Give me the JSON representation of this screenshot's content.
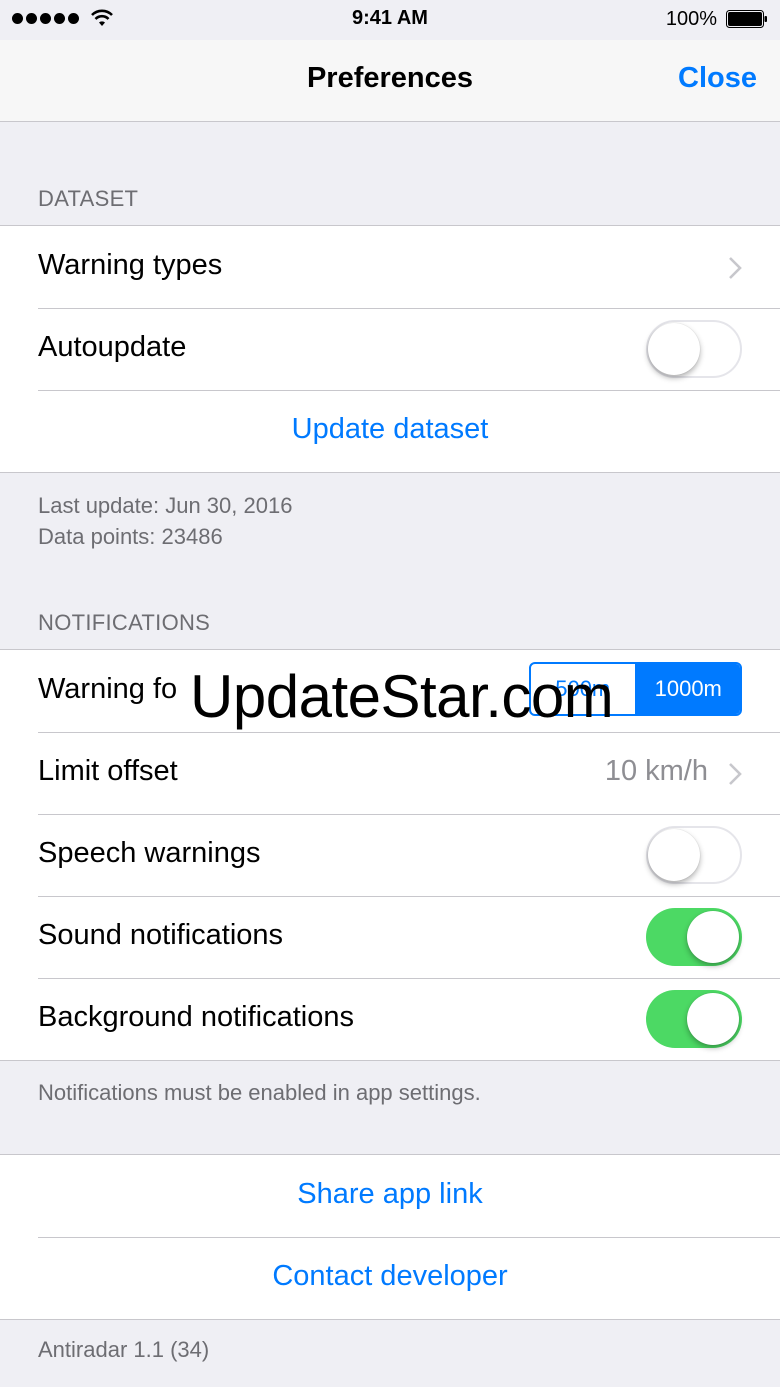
{
  "status_bar": {
    "time": "9:41 AM",
    "battery_percent": "100%",
    "signal_icon": "signal-dots-icon",
    "wifi_icon": "wifi-icon",
    "battery_icon": "battery-icon"
  },
  "nav": {
    "title": "Preferences",
    "close_label": "Close"
  },
  "dataset": {
    "header": "DATASET",
    "warning_types_label": "Warning types",
    "autoupdate_label": "Autoupdate",
    "autoupdate_on": false,
    "update_action": "Update dataset",
    "footer_line1": "Last update: Jun 30, 2016",
    "footer_line2": "Data points: 23486"
  },
  "notifications": {
    "header": "NOTIFICATIONS",
    "warning_for_label": "Warning fo",
    "distance_options": [
      "500m",
      "1000m"
    ],
    "distance_selected": "1000m",
    "limit_offset_label": "Limit offset",
    "limit_offset_value": "10 km/h",
    "speech_label": "Speech warnings",
    "speech_on": false,
    "sound_label": "Sound notifications",
    "sound_on": true,
    "background_label": "Background notifications",
    "background_on": true,
    "footer": "Notifications must be enabled in app settings."
  },
  "actions": {
    "share_label": "Share app link",
    "contact_label": "Contact developer"
  },
  "version": "Antiradar 1.1 (34)",
  "watermark": "UpdateStar.com",
  "colors": {
    "accent": "#007aff",
    "switch_on": "#4cd964",
    "background": "#efeff4",
    "secondary_text": "#6d6d72"
  }
}
